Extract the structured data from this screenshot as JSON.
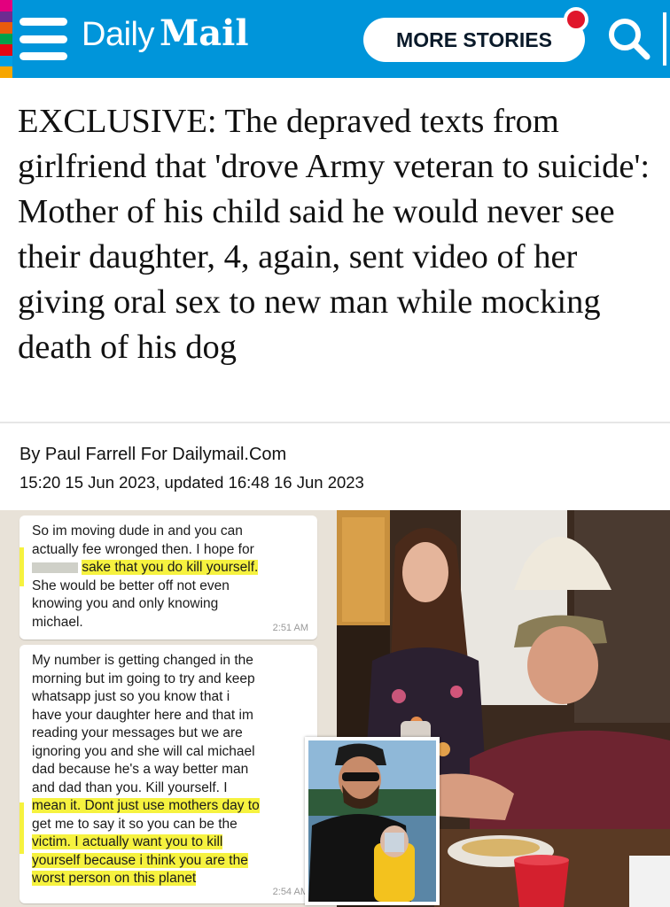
{
  "header": {
    "brand_daily": "Daily",
    "brand_mail": "Mail",
    "more_stories_label": "MORE STORIES",
    "icons": [
      "menu-icon",
      "search-icon",
      "notification-dot"
    ],
    "colors": {
      "bar": "#0095da",
      "dot": "#e0162b"
    }
  },
  "article": {
    "headline": "EXCLUSIVE: The depraved texts from girlfriend that 'drove Army veteran to suicide': Mother of his child said he would never see their daughter, 4, again, sent video of her giving oral sex to new man while mocking death of his dog",
    "byline_prefix": "By ",
    "author": "Paul Farrell",
    "byline_suffix": " For Dailymail.Com",
    "dateline": "15:20 15 Jun 2023, updated 16:48 16 Jun 2023"
  },
  "messages": [
    {
      "lines": [
        "So im moving dude in and you can",
        "actually fee wronged then. I hope for",
        "sake that you do kill yourself.",
        "She would be better off not even",
        "knowing you and only knowing",
        "michael."
      ],
      "time": "2:51 AM"
    },
    {
      "lines": [
        "My number is getting changed in the",
        "morning but im going to try and keep",
        "whatsapp just so you know that i",
        "have your daughter here and that im",
        "reading your messages but we are",
        "ignoring you and she will cal michael",
        "dad because he's a way better man",
        "and dad than you. Kill yourself. I",
        "mean it. Dont just use mothers day to",
        "get me to say it so you can be the",
        "victim. I actually want you to kill",
        "yourself because i think you are the",
        "worst person on this planet"
      ],
      "time": "2:54 AM"
    }
  ]
}
